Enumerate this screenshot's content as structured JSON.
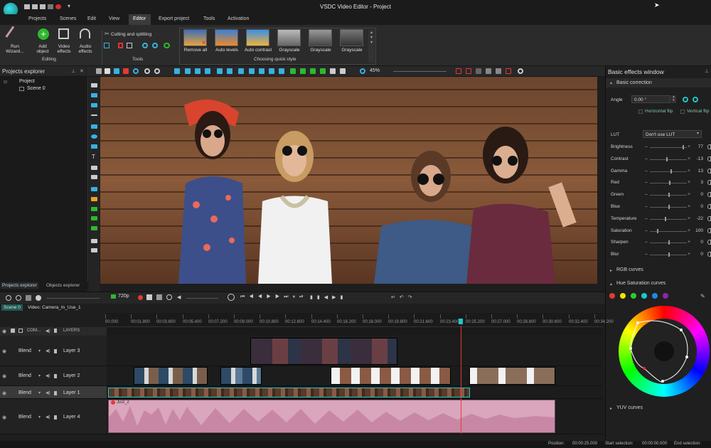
{
  "app": {
    "title": "VSDC Video Editor - Project"
  },
  "menu": [
    "Projects",
    "Scenes",
    "Edit",
    "View",
    "Editor",
    "Export project",
    "Tools",
    "Activation"
  ],
  "ribbon": {
    "run_wizard": "Run\nWizard...",
    "add_object": "Add\nobject",
    "video_effects": "Video\neffects",
    "audio_effects": "Audio\neffects",
    "editing_group": "Editing",
    "cutting": "Cutting and splitting",
    "tools_group": "Tools",
    "quick_styles": [
      "Remove all",
      "Auto levels",
      "Auto contrast",
      "Grayscale",
      "Grayscale",
      "Grayscale"
    ],
    "quick_style_group": "Choosing quick style"
  },
  "toolbar": {
    "zoom": "45%"
  },
  "projects_explorer": {
    "title": "Projects explorer",
    "root": "Project",
    "scene": "Scene 0"
  },
  "explorer_tabs": [
    "Projects explorer",
    "Objects explorer"
  ],
  "effects": {
    "title": "Basic effects window",
    "basic_correction": "Basic correction",
    "angle_label": "Angle",
    "angle_value": "0.00 °",
    "hflip": "Horizontal flip",
    "vflip": "Vertical flip",
    "lut_label": "LUT",
    "lut_value": "Don't use LUT",
    "params": [
      {
        "label": "Brightness",
        "value": "77",
        "level": 0.88
      },
      {
        "label": "Contrast",
        "value": "-13",
        "level": 0.44
      },
      {
        "label": "Gamma",
        "value": "13",
        "level": 0.56
      },
      {
        "label": "Red",
        "value": "3",
        "level": 0.52
      },
      {
        "label": "Green",
        "value": "0",
        "level": 0.5
      },
      {
        "label": "Blue",
        "value": "0",
        "level": 0.5
      },
      {
        "label": "Temperature",
        "value": "-22",
        "level": 0.4
      },
      {
        "label": "Saturation",
        "value": "100",
        "level": 0.2
      },
      {
        "label": "Sharpen",
        "value": "0",
        "level": 0.5
      },
      {
        "label": "Blur",
        "value": "0",
        "level": 0.5
      }
    ],
    "rgb_curves": "RGB curves",
    "hue_sat": "Hue Saturation curves",
    "yuv_curves": "YUV curves",
    "swatches": [
      "#e53935",
      "#f1e400",
      "#28d12a",
      "#1ec7c7",
      "#1e88e5",
      "#8e24aa"
    ]
  },
  "timeline": {
    "resolution": "720p",
    "tabs": [
      "Scene 0",
      "Video: Camera_In_Use_1"
    ],
    "columns": "COM...",
    "layers_label": "LAYERS",
    "ruler": [
      "00.000",
      "00:01.800",
      "00:03.600",
      "00:05.400",
      "00:07.200",
      "00:09.000",
      "00:10.800",
      "00:12.600",
      "00:14.400",
      "00:16.200",
      "00:18.000",
      "00:19.800",
      "00:21.600",
      "00:23.400",
      "00:25.200",
      "00:27.000",
      "00:28.800",
      "00:30.600",
      "00:32.400",
      "00:34.200"
    ],
    "layers": [
      {
        "blend": "Blend",
        "name": "Layer 3"
      },
      {
        "blend": "Blend",
        "name": "Layer 2"
      },
      {
        "blend": "Blend",
        "name": "Layer 1"
      },
      {
        "blend": "Blend",
        "name": "Layer 4"
      }
    ],
    "audio_clip": "Just_2"
  },
  "status": {
    "position_label": "Position:",
    "position": "00:00:25.000",
    "start_label": "Start selection:",
    "start": "00:00:00.000",
    "end_label": "End selection:"
  }
}
